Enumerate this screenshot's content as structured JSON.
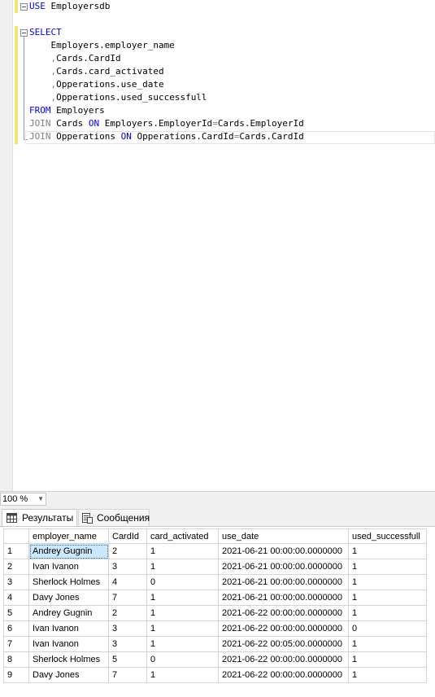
{
  "editor": {
    "lines": [
      {
        "parts": [
          {
            "t": "USE",
            "c": "kw"
          },
          {
            "t": " Employersdb",
            "c": ""
          }
        ]
      },
      {
        "parts": []
      },
      {
        "parts": [
          {
            "t": "SELECT",
            "c": "kw"
          }
        ]
      },
      {
        "parts": [
          {
            "t": "    Employers.employer_name",
            "c": ""
          }
        ]
      },
      {
        "parts": [
          {
            "t": "    ",
            "c": ""
          },
          {
            "t": ",",
            "c": "gray"
          },
          {
            "t": "Cards.CardId",
            "c": ""
          }
        ]
      },
      {
        "parts": [
          {
            "t": "    ",
            "c": ""
          },
          {
            "t": ",",
            "c": "gray"
          },
          {
            "t": "Cards.card_activated",
            "c": ""
          }
        ]
      },
      {
        "parts": [
          {
            "t": "    ",
            "c": ""
          },
          {
            "t": ",",
            "c": "gray"
          },
          {
            "t": "Opperations.use_date",
            "c": ""
          }
        ]
      },
      {
        "parts": [
          {
            "t": "    ",
            "c": ""
          },
          {
            "t": ",",
            "c": "gray"
          },
          {
            "t": "Opperations.used_successfull",
            "c": ""
          }
        ]
      },
      {
        "parts": [
          {
            "t": "FROM",
            "c": "kw"
          },
          {
            "t": " Employers",
            "c": ""
          }
        ]
      },
      {
        "parts": [
          {
            "t": "JOIN",
            "c": "gray"
          },
          {
            "t": " Cards ",
            "c": ""
          },
          {
            "t": "ON",
            "c": "kw"
          },
          {
            "t": " Employers.EmployerId",
            "c": ""
          },
          {
            "t": "=",
            "c": "gray"
          },
          {
            "t": "Cards.EmployerId",
            "c": ""
          }
        ]
      },
      {
        "parts": [
          {
            "t": "JOIN",
            "c": "gray"
          },
          {
            "t": " Opperations ",
            "c": ""
          },
          {
            "t": "ON",
            "c": "kw"
          },
          {
            "t": " Opperations.CardId",
            "c": ""
          },
          {
            "t": "=",
            "c": "gray"
          },
          {
            "t": "Cards.CardId",
            "c": ""
          }
        ]
      }
    ]
  },
  "zoom": {
    "value": "100 %"
  },
  "tabs": {
    "results": "Результаты",
    "messages": "Сообщения"
  },
  "grid": {
    "columns": [
      "employer_name",
      "CardId",
      "card_activated",
      "use_date",
      "used_successfull"
    ],
    "rows": [
      [
        "1",
        "Andrey Gugnin",
        "2",
        "1",
        "2021-06-21 00:00:00.0000000",
        "1"
      ],
      [
        "2",
        "Ivan Ivanon",
        "3",
        "1",
        "2021-06-21 00:00:00.0000000",
        "1"
      ],
      [
        "3",
        "Sherlock Holmes",
        "4",
        "0",
        "2021-06-21 00:00:00.0000000",
        "1"
      ],
      [
        "4",
        "Davy Jones",
        "7",
        "1",
        "2021-06-21 00:00:00.0000000",
        "1"
      ],
      [
        "5",
        "Andrey Gugnin",
        "2",
        "1",
        "2021-06-22 00:00:00.0000000",
        "1"
      ],
      [
        "6",
        "Ivan Ivanon",
        "3",
        "1",
        "2021-06-22 00:00:00.0000000",
        "0"
      ],
      [
        "7",
        "Ivan Ivanon",
        "3",
        "1",
        "2021-06-22 00:05:00.0000000",
        "1"
      ],
      [
        "8",
        "Sherlock Holmes",
        "5",
        "0",
        "2021-06-22 00:00:00.0000000",
        "1"
      ],
      [
        "9",
        "Davy Jones",
        "7",
        "1",
        "2021-06-22 00:00:00.0000000",
        "1"
      ]
    ]
  },
  "colors": {
    "keyword": "#0000ff",
    "operator": "#808080",
    "selection": "#cce8ff",
    "change_bar": "#f7e36b"
  }
}
